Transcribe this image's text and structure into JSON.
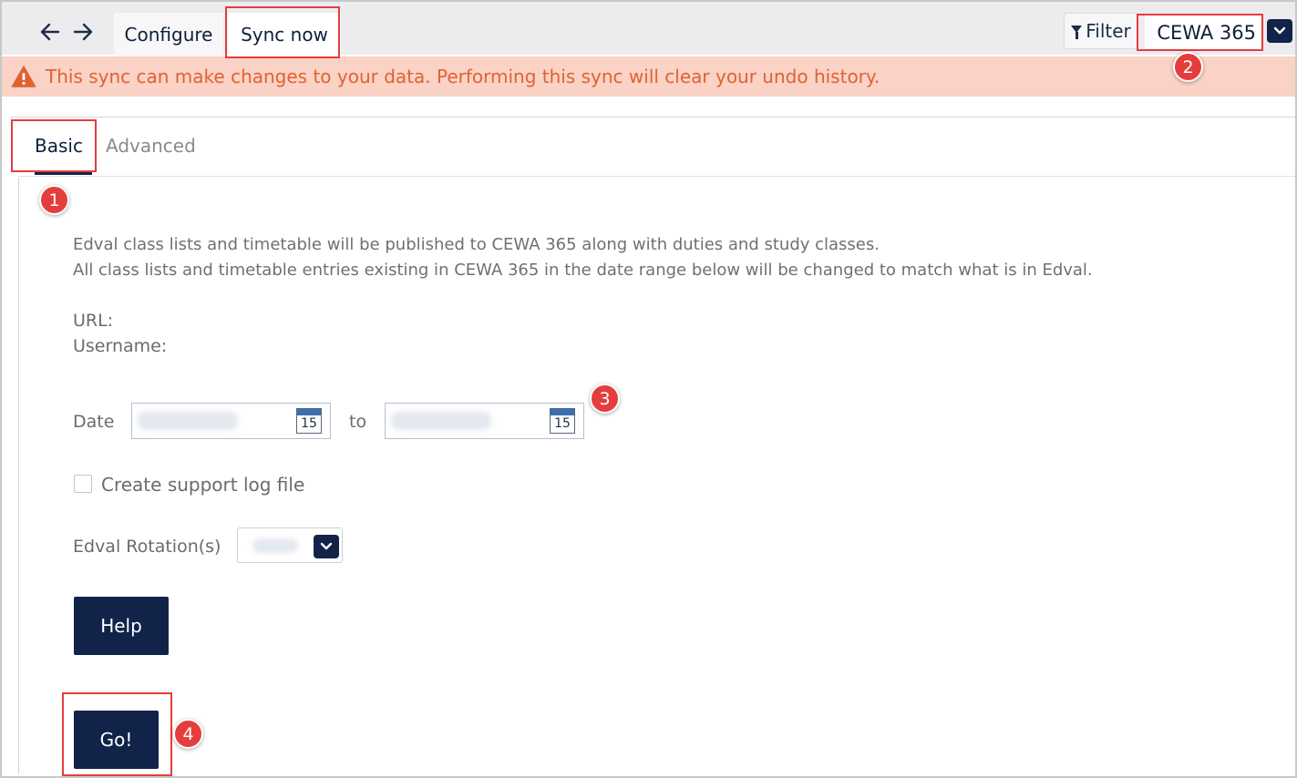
{
  "header": {
    "nav_back_icon": "arrow-left-icon",
    "nav_forward_icon": "arrow-right-icon",
    "tabs": [
      {
        "label": "Configure"
      },
      {
        "label": "Sync now"
      }
    ],
    "filter_label": "Filter",
    "filter_icon": "funnel-icon",
    "system_selected": "CEWA 365"
  },
  "warning": {
    "icon": "warning-triangle-icon",
    "text": "This sync can make changes to your data. Performing this sync will clear your undo history."
  },
  "subtabs": [
    {
      "label": "Basic"
    },
    {
      "label": "Advanced"
    }
  ],
  "form": {
    "description_line1": "Edval class lists and timetable will be published to CEWA 365 along with duties and study classes.",
    "description_line2": "All class lists and timetable entries existing in CEWA 365 in the date range below will be changed to match what is in Edval.",
    "url_label": "URL:",
    "username_label": "Username:",
    "date_label": "Date",
    "to_label": "to",
    "calendar_day": "15",
    "support_log_label": "Create support log file",
    "rotation_label": "Edval Rotation(s)",
    "help_label": "Help",
    "go_label": "Go!"
  },
  "annotations": {
    "badges": [
      "1",
      "2",
      "3",
      "4"
    ],
    "color": "#e53d3d"
  },
  "colors": {
    "primary": "#12234a",
    "warning_bg": "#fad2c6",
    "warning_text": "#e0632f"
  }
}
